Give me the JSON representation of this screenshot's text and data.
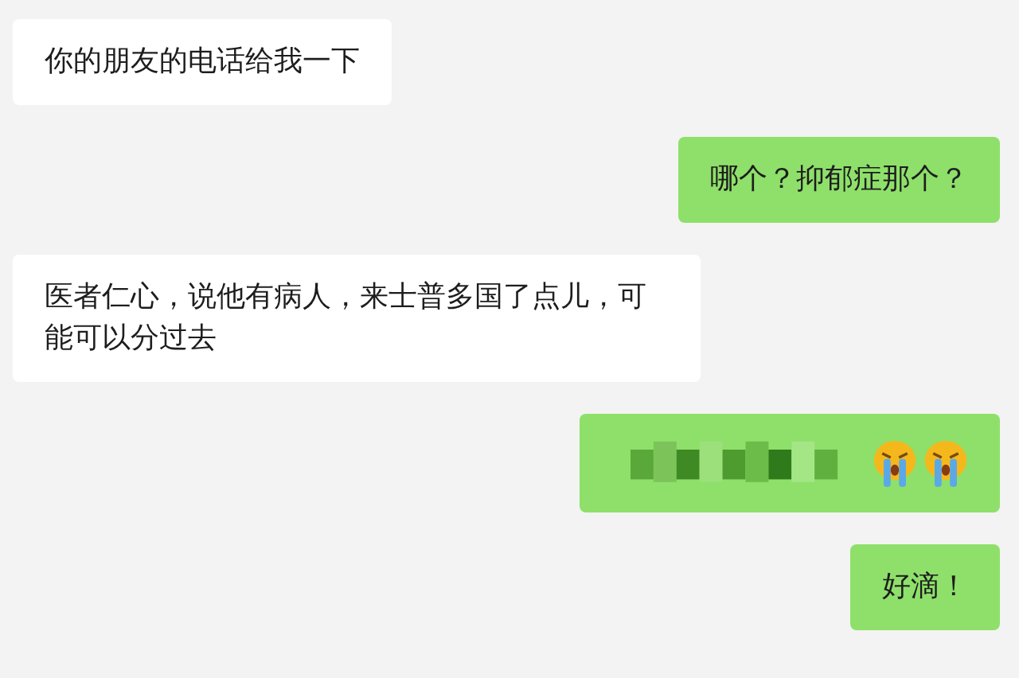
{
  "messages": [
    {
      "outgoing": false,
      "parts": [
        {
          "kind": "text",
          "text": "你的朋友的电话给我一下"
        }
      ]
    },
    {
      "outgoing": true,
      "parts": [
        {
          "kind": "text",
          "text": "哪个？抑郁症那个？"
        }
      ]
    },
    {
      "outgoing": false,
      "parts": [
        {
          "kind": "text",
          "text": "医者仁心，说他有病人，来士普多国了点儿，可能可以分过去"
        }
      ]
    },
    {
      "outgoing": true,
      "parts": [
        {
          "kind": "redacted"
        },
        {
          "kind": "crying-emoji"
        },
        {
          "kind": "crying-emoji"
        }
      ]
    },
    {
      "outgoing": true,
      "parts": [
        {
          "kind": "text",
          "text": "好滴！"
        }
      ]
    }
  ]
}
